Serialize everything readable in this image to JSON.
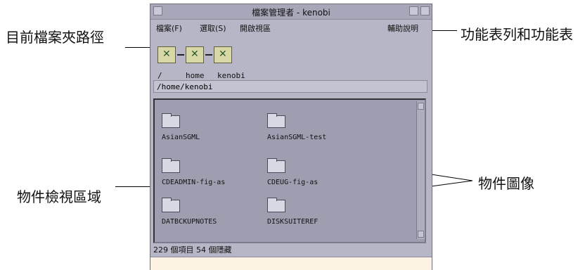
{
  "callouts": {
    "path": "目前檔案夾路徑",
    "menubar": "功能表列和功能表",
    "objects": "物件圖像",
    "view": "物件檢視區域"
  },
  "window": {
    "title": "檔案管理者 - kenobi",
    "menu": {
      "file": "檔案(F)",
      "select": "選取(S)",
      "open_view": "開啟視區",
      "help": "輔助說明"
    },
    "breadcrumbs": [
      "/",
      "home",
      "kenobi"
    ],
    "path_value": "/home/kenobi",
    "objects": [
      {
        "name": "AsianSGML",
        "icon": "folder-icon"
      },
      {
        "name": "AsianSGML-test",
        "icon": "folder-icon"
      },
      {
        "name": "CDEADMIN-fig-as",
        "icon": "folder-icon"
      },
      {
        "name": "CDEUG-fig-as",
        "icon": "folder-icon"
      },
      {
        "name": "DATBCKUPNOTES",
        "icon": "folder-icon"
      },
      {
        "name": "DISKSUITEREF",
        "icon": "folder-icon"
      }
    ],
    "status": "229 個項目 54 個隱藏"
  }
}
